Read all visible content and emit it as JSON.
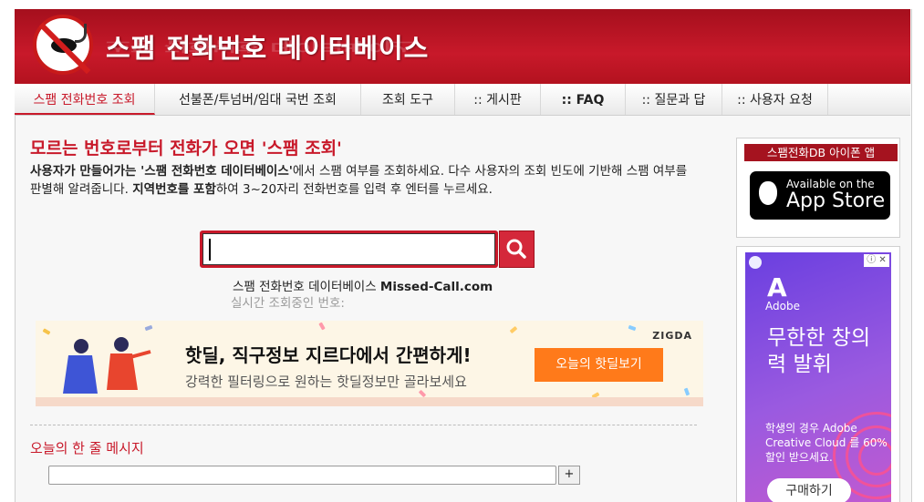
{
  "header": {
    "title": "스팸 전화번호 데이터베이스",
    "logo_icon": "no-fishing-icon"
  },
  "nav": {
    "items": [
      {
        "label": "스팸 전화번호 조회",
        "active": true
      },
      {
        "label": "선불폰/투넘버/임대 국번 조회",
        "active": false
      },
      {
        "label": "조회 도구",
        "active": false
      },
      {
        "label": ":: 게시판",
        "active": false
      },
      {
        "label": ":: FAQ",
        "active": false
      },
      {
        "label": ":: 질문과 답",
        "active": false
      },
      {
        "label": ":: 사용자 요청",
        "active": false
      }
    ]
  },
  "main": {
    "heading": "모르는 번호로부터 전화가 오면 '스팸 조회'",
    "desc": {
      "p1": "사용자가 만들어가는 '스팸 전화번호 데이터베이스'",
      "p2": "에서 스팸 여부를 조회하세요. 다수 사용자의 조회 빈도에 기반해 스팸 여부를 판별해 알려줍니다. ",
      "p3": "지역번호를 포함",
      "p4": "하여 3~20자리 전화번호를 입력 후 엔터를 누르세요."
    },
    "search": {
      "value": "",
      "button_icon": "search-icon"
    },
    "brand_line": {
      "name": "스팸 전화번호 데이터베이스",
      "domain": "Missed-Call.com"
    },
    "realtime_label": "실시간 조회중인 번호:"
  },
  "ad_banner": {
    "brand": "ZIGDA",
    "headline": "핫딜, 직구정보 지르다에서 간편하게!",
    "subline": "강력한 필터링으로 원하는 핫딜정보만 골라보세요",
    "button": "오늘의 핫딜보기"
  },
  "message": {
    "heading": "오늘의 한 줄 메시지",
    "input_value": "",
    "add_button": "+"
  },
  "sidebar": {
    "app_heading": "스팸전화DB 아이폰 앱",
    "appstore_small": "Available on the",
    "appstore_big": "App Store",
    "ad": {
      "brand": "Adobe",
      "headline": "무한한 창의력 발휘",
      "body": "학생의 경우 Adobe Creative Cloud 를 60% 할인 받으세요.",
      "cta": "구매하기"
    }
  },
  "colors": {
    "brand_red": "#c8192a",
    "header_dark": "#a50f1d",
    "ad_button": "#ff7a1a"
  }
}
